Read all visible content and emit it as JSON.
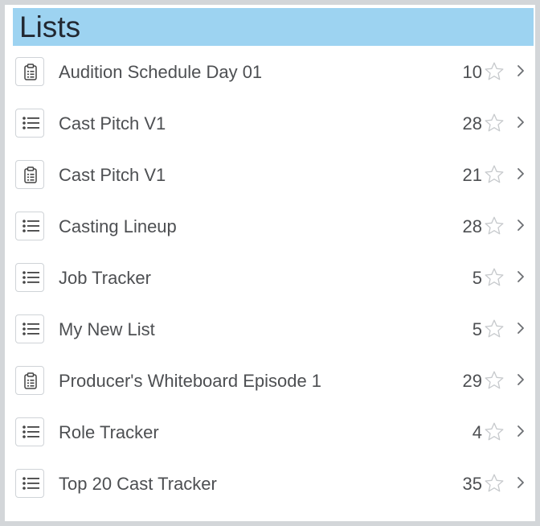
{
  "header": {
    "title": "Lists"
  },
  "lists": [
    {
      "icon": "clipboard-icon",
      "name": "Audition Schedule Day 01",
      "count": "10"
    },
    {
      "icon": "list-icon",
      "name": "Cast Pitch V1",
      "count": "28"
    },
    {
      "icon": "clipboard-icon",
      "name": "Cast Pitch V1",
      "count": "21"
    },
    {
      "icon": "list-icon",
      "name": "Casting Lineup",
      "count": "28"
    },
    {
      "icon": "list-icon",
      "name": "Job Tracker",
      "count": "5"
    },
    {
      "icon": "list-icon",
      "name": "My New List",
      "count": "5"
    },
    {
      "icon": "clipboard-icon",
      "name": "Producer's Whiteboard Episode 1",
      "count": "29"
    },
    {
      "icon": "list-icon",
      "name": "Role Tracker",
      "count": "4"
    },
    {
      "icon": "list-icon",
      "name": "Top 20 Cast Tracker",
      "count": "35"
    }
  ]
}
